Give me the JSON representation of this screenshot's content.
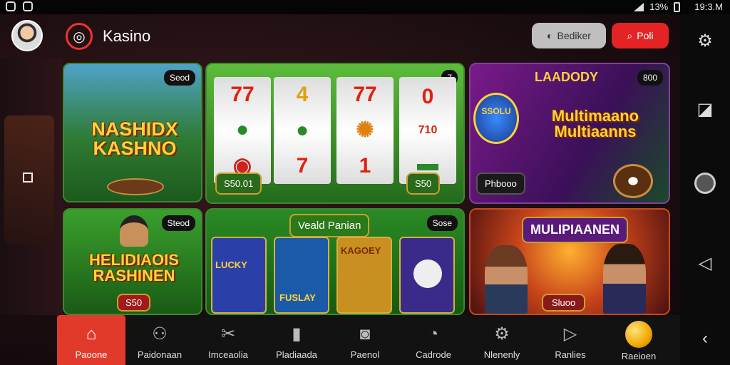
{
  "status_bar": {
    "battery": "13%",
    "time": "19:3.M"
  },
  "header": {
    "app_title": "Kasino",
    "secondary_button": "Bediker",
    "primary_button": "Poli"
  },
  "cards": [
    {
      "title": "NASHIDX KASHNO",
      "badge": "Seod"
    },
    {
      "badge": "7",
      "bottom_left": "S50.01",
      "bottom_right": "S50"
    },
    {
      "top_text": "LAADODY",
      "title": "Multimaano Multiaanns",
      "badge": "800",
      "coin_text": "SSOLU",
      "bottom_left": "Phbooo"
    },
    {
      "title": "HELIDIAOIS RASHINEN",
      "badge": "Steod",
      "pill": "S50"
    },
    {
      "title": "Veald Panian",
      "badge": "Sose",
      "tiles": [
        "LUCKY",
        "FUSLAY",
        "KAGOEY",
        ""
      ]
    },
    {
      "title": "MULIPIAANEN",
      "pill": "Sluoo"
    }
  ],
  "reels": {
    "col1": [
      "77",
      "",
      ""
    ],
    "col2": [
      "4",
      "",
      "7"
    ],
    "col3": [
      "77",
      "",
      "1"
    ],
    "col4": [
      "0",
      "710",
      ""
    ]
  },
  "bottom_nav": [
    {
      "label": "Paoone",
      "icon": "home-icon",
      "active": true
    },
    {
      "label": "Paidonaan",
      "icon": "people-icon",
      "active": false
    },
    {
      "label": "Imceaolia",
      "icon": "tools-icon",
      "active": false
    },
    {
      "label": "Pladiaada",
      "icon": "bookmark-icon",
      "active": false
    },
    {
      "label": "Paenol",
      "icon": "camera-icon",
      "active": false
    },
    {
      "label": "Cadrode",
      "icon": "chat-icon",
      "active": false
    },
    {
      "label": "Nlenenly",
      "icon": "gear-icon",
      "active": false
    },
    {
      "label": "Ranlies",
      "icon": "play-icon",
      "active": false
    },
    {
      "label": "Raeioen",
      "icon": "coin-icon",
      "active": false
    }
  ]
}
